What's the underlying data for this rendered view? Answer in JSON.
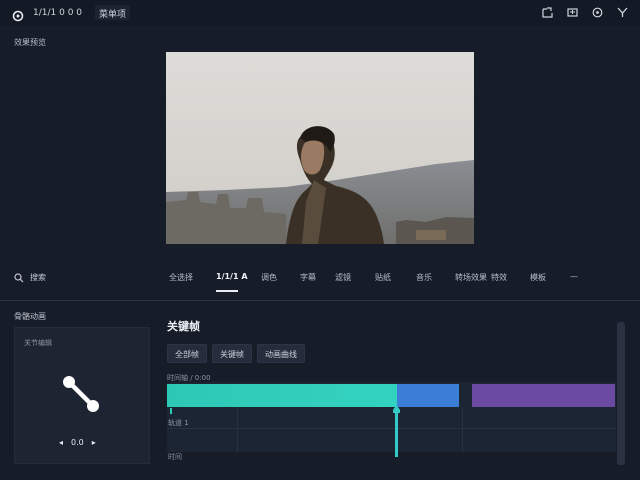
{
  "topbar": {
    "project_name": "1/1/1 0 0 0",
    "menu_label": "菜单项",
    "icons": [
      "logo-icon",
      "export-icon",
      "expand-icon",
      "settings-icon",
      "share-icon"
    ]
  },
  "preview": {
    "label": "效果预览"
  },
  "tools": {
    "row_label": "搜索",
    "tabs": [
      "全选择",
      "1/1/1 A",
      "调色",
      "字幕",
      "滤镜",
      "贴纸",
      "音乐",
      "转场效果",
      "特效",
      "模板",
      "—"
    ],
    "active_index": 1
  },
  "left_panel": {
    "title": "骨骼动画",
    "subtitle": "关节编辑",
    "control_value": "0.0"
  },
  "editor": {
    "title": "关键帧",
    "pills": [
      "全部帧",
      "关键帧",
      "动画曲线"
    ],
    "track_label": "时间轴 / 0:00",
    "track_row_label": "轨道 1",
    "bottom_label": "时间"
  },
  "colors": {
    "teal_clip": "#2ec9b5",
    "blue_clip": "#3a7ed6",
    "purple_clip": "#6b4aa3",
    "playhead": "#35c9c6"
  }
}
